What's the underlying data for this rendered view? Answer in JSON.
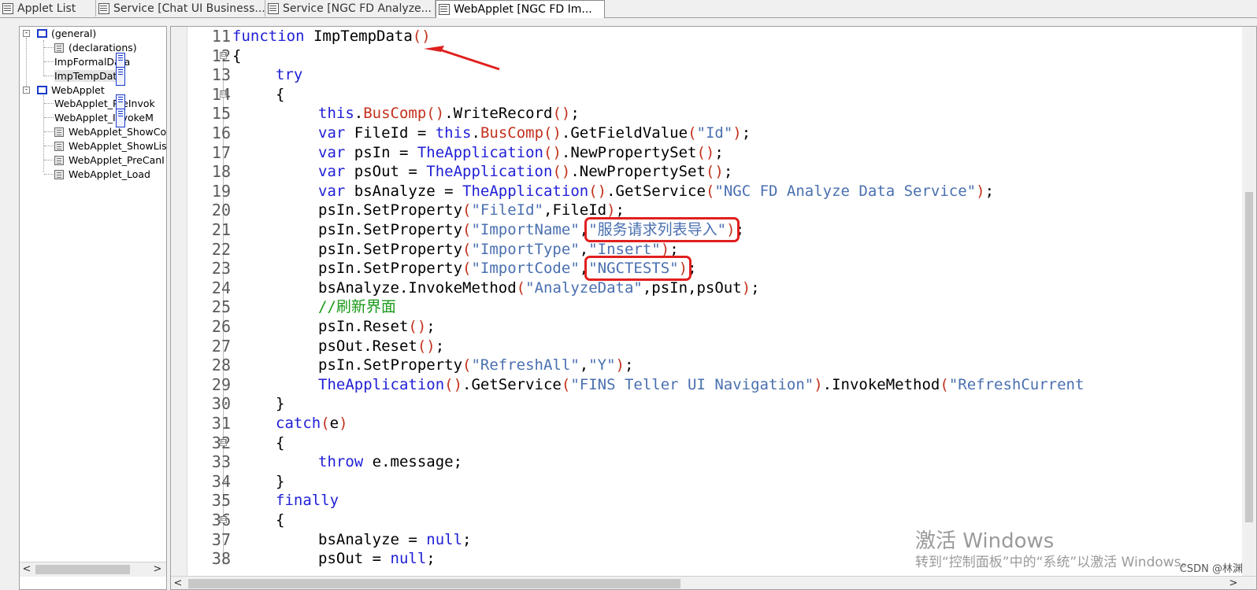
{
  "tabs": [
    {
      "label": "Applet List",
      "active": false
    },
    {
      "label": "Service [Chat UI Business...",
      "active": false
    },
    {
      "label": "Service [NGC FD Analyze...",
      "active": false
    },
    {
      "label": "WebApplet [NGC FD Im...",
      "active": true
    }
  ],
  "tree": {
    "general": {
      "label": "(general)",
      "expander": "-"
    },
    "general_items": [
      "(declarations)",
      "ImpFormalData",
      "ImpTempData"
    ],
    "webapplet": {
      "label": "WebApplet",
      "expander": "-"
    },
    "webapplet_items": [
      "WebApplet_PreInvok",
      "WebApplet_InvokeM",
      "WebApplet_ShowCo",
      "WebApplet_ShowLis",
      "WebApplet_PreCanI",
      "WebApplet_Load"
    ]
  },
  "editor": {
    "line_numbers": [
      "11",
      "12",
      "13",
      "14",
      "15",
      "16",
      "17",
      "18",
      "19",
      "20",
      "21",
      "22",
      "23",
      "24",
      "25",
      "26",
      "27",
      "28",
      "29",
      "30",
      "31",
      "32",
      "33",
      "34",
      "35",
      "36",
      "37",
      "38"
    ],
    "fold_open": "⊟",
    "lines": {
      "l11": {
        "kw": "function",
        "name": " ImpTempData",
        "paren": "()"
      },
      "l12": "{",
      "l13": "try",
      "l14": "{",
      "l15": {
        "a": "this",
        "b": ".",
        "c": "BusComp",
        "d": "()",
        "e": ".WriteRecord",
        "f": "()",
        "g": ";"
      },
      "l16": {
        "a": "var",
        "b": " FileId = ",
        "c": "this",
        "d": ".",
        "e": "BusComp",
        "f": "()",
        "g": ".GetFieldValue",
        "h": "(",
        "i": "\"Id\"",
        "j": ")",
        "k": ";"
      },
      "l17": {
        "a": "var",
        "b": " psIn = ",
        "c": "TheApplication",
        "d": "()",
        "e": ".NewPropertySet",
        "f": "()",
        "g": ";"
      },
      "l18": {
        "a": "var",
        "b": " psOut = ",
        "c": "TheApplication",
        "d": "()",
        "e": ".NewPropertySet",
        "f": "()",
        "g": ";"
      },
      "l19": {
        "a": "var",
        "b": " bsAnalyze = ",
        "c": "TheApplication",
        "d": "()",
        "e": ".GetService",
        "f": "(",
        "g": "\"NGC FD Analyze Data Service\"",
        "h": ")",
        "i": ";"
      },
      "l20": {
        "a": "psIn.SetProperty",
        "b": "(",
        "c": "\"FileId\"",
        "d": ",FileId",
        "e": ")",
        "f": ";"
      },
      "l21": {
        "a": "psIn.SetProperty",
        "b": "(",
        "c": "\"ImportName\"",
        "d": ",",
        "e": "\"服务请求列表导入\"",
        "f": ")",
        "g": ";"
      },
      "l22": {
        "a": "psIn.SetProperty",
        "b": "(",
        "c": "\"ImportType\"",
        "d": ",",
        "e": "\"Insert\"",
        "f": ")",
        "g": ";"
      },
      "l23": {
        "a": "psIn.SetProperty",
        "b": "(",
        "c": "\"ImportCode\"",
        "d": ",",
        "e": "\"NGCTESTS\"",
        "f": ")",
        "g": ";"
      },
      "l24": {
        "a": "bsAnalyze.InvokeMethod",
        "b": "(",
        "c": "\"AnalyzeData\"",
        "d": ",psIn,psOut",
        "e": ")",
        "f": ";"
      },
      "l25": "//刷新界面",
      "l26": {
        "a": "psIn.Reset",
        "b": "()",
        "c": ";"
      },
      "l27": {
        "a": "psOut.Reset",
        "b": "()",
        "c": ";"
      },
      "l28": {
        "a": "psIn.SetProperty",
        "b": "(",
        "c": "\"RefreshAll\"",
        "d": ",",
        "e": "\"Y\"",
        "f": ")",
        "g": ";"
      },
      "l29": {
        "a": "TheApplication",
        "b": "()",
        "c": ".GetService",
        "d": "(",
        "e": "\"FINS Teller UI Navigation\"",
        "f": ")",
        "g": ".InvokeMethod",
        "h": "(",
        "i": "\"RefreshCurrent"
      },
      "l30": "}",
      "l31": {
        "a": "catch",
        "b": "(",
        "c": "e",
        "d": ")"
      },
      "l32": "{",
      "l33": {
        "a": "throw",
        "b": " e.message;"
      },
      "l34": "}",
      "l35": "finally",
      "l36": "{",
      "l37": {
        "a": "bsAnalyze = ",
        "b": "null",
        "c": ";"
      },
      "l38": {
        "a": "psOut = ",
        "b": "null",
        "c": ";"
      }
    }
  },
  "watermark": {
    "line1": "激活 Windows",
    "line2": "转到“控制面板”中的“系统”以激活 Windows。"
  },
  "credit": "CSDN @林渊",
  "colors": {
    "keyword": "#1f1fd6",
    "string": "#4a70b0",
    "paren": "#c3311d",
    "comment": "#1a9a1a",
    "highlight": "#e0201e"
  },
  "scroll_arrows": {
    "left": "<",
    "right": ">"
  }
}
